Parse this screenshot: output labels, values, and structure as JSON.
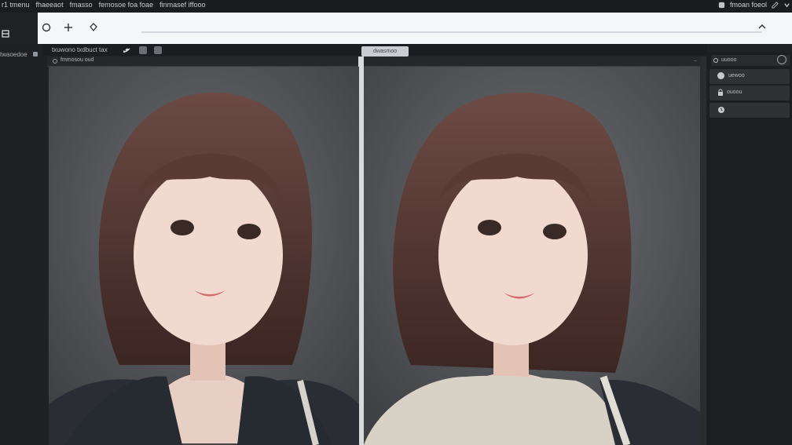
{
  "menubar": {
    "items": [
      "r1 tmenu",
      "fhaeeaot",
      "fmasso",
      "femosoe foa foae",
      "finmasef iffooo"
    ],
    "right_label": "fmoan foeol"
  },
  "sidebar": {
    "label": "twaoedoe"
  },
  "tabs": {
    "active_tab_label": "txuwono txdbuct tax",
    "second_pane_tab": "dwasmoo"
  },
  "panes": {
    "left_caption": "fmmosou oud"
  },
  "right_panel": {
    "header_label": "uuooo",
    "items": [
      {
        "label": "uewoo"
      },
      {
        "label": "ouoou"
      },
      {
        "label": ""
      }
    ]
  },
  "colors": {
    "accent": "#c9ccd0",
    "background": "#202124"
  }
}
